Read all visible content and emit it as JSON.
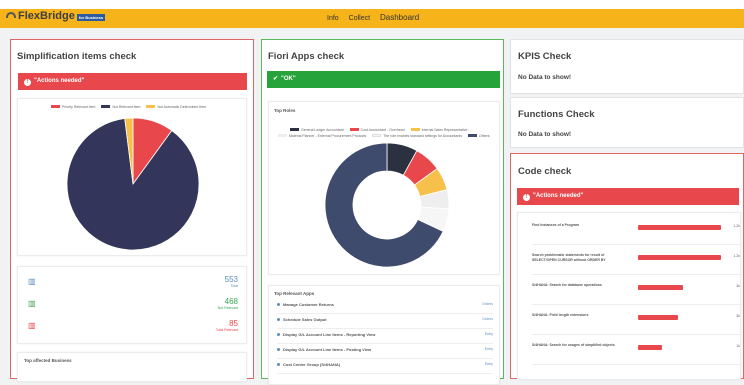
{
  "header": {
    "logo_text": "FlexBridge",
    "logo_sub": "for Business",
    "nav": [
      "Info",
      "Collect",
      "Dashboard"
    ]
  },
  "simplification": {
    "title": "Simplification items check",
    "alert": "\"Actions needed\"",
    "legend": [
      "Priority Relevant Item",
      "Not Relevant Item",
      "Not Automatic Determined Item"
    ],
    "pie_colors": [
      "#e8484b",
      "#33365a",
      "#f7c04a"
    ],
    "pie_values": [
      0.1,
      0.88,
      0.02
    ],
    "stats": [
      {
        "value": "553",
        "label": "Total",
        "color": "#5a8fbf"
      },
      {
        "value": "468",
        "label": "Not Relevant",
        "color": "#3aa655"
      },
      {
        "value": "85",
        "label": "Total Relevant",
        "color": "#e8484b"
      }
    ],
    "footer_title": "Top affected Business"
  },
  "fiori": {
    "title": "Fiori Apps check",
    "alert": "\"OK\"",
    "roles_title": "Top Roles",
    "roles_legend": [
      [
        "General Ledger Accountant",
        "Cost Accountant - Overhead",
        "Internal Sales Representative"
      ],
      [
        "Material Planner - External Procurement Products",
        "The role enables standard settings for Accountants",
        "Others"
      ]
    ],
    "donut_colors": [
      "#2c3140",
      "#e8484b",
      "#f7c04a",
      "#eeeeee",
      "#f6f6f6",
      "#3e4b6d"
    ],
    "donut_values": [
      0.08,
      0.07,
      0.06,
      0.05,
      0.06,
      0.68
    ],
    "apps_title": "Top Relevant Apps",
    "apps": [
      {
        "name": "Manage Customer Returns",
        "tail": "Orders"
      },
      {
        "name": "Schedule Sales Output",
        "tail": "Orders"
      },
      {
        "name": "Display G/L Account Line Items - Reporting View",
        "tail": "Entry"
      },
      {
        "name": "Display G/L Account Line Items - Posting View",
        "tail": "Entry"
      },
      {
        "name": "Cost Center Group (S/4HANA)",
        "tail": "Entry"
      }
    ]
  },
  "kpis": {
    "title": "KPIS Check",
    "text": "No Data to show!"
  },
  "functions": {
    "title": "Functions Check",
    "text": "No Data to show!"
  },
  "code": {
    "title": "Code check",
    "alert": "\"Actions needed\"",
    "rows": [
      {
        "text": "Find Instances of a Program",
        "value": "1.2k",
        "fraction": 0.97
      },
      {
        "text": "Search problematic statements for result of SELECT/OPEN CURSOR without ORDER BY",
        "value": "1.2k",
        "fraction": 0.96
      },
      {
        "text": "S/4HANA: Search for database operations",
        "value": "3k",
        "fraction": 0.52
      },
      {
        "text": "S/4HANA: Field length extensions",
        "value": "3k",
        "fraction": 0.46
      },
      {
        "text": "S/4HANA: Search for usages of simplified objects",
        "value": "1k",
        "fraction": 0.28
      }
    ]
  }
}
